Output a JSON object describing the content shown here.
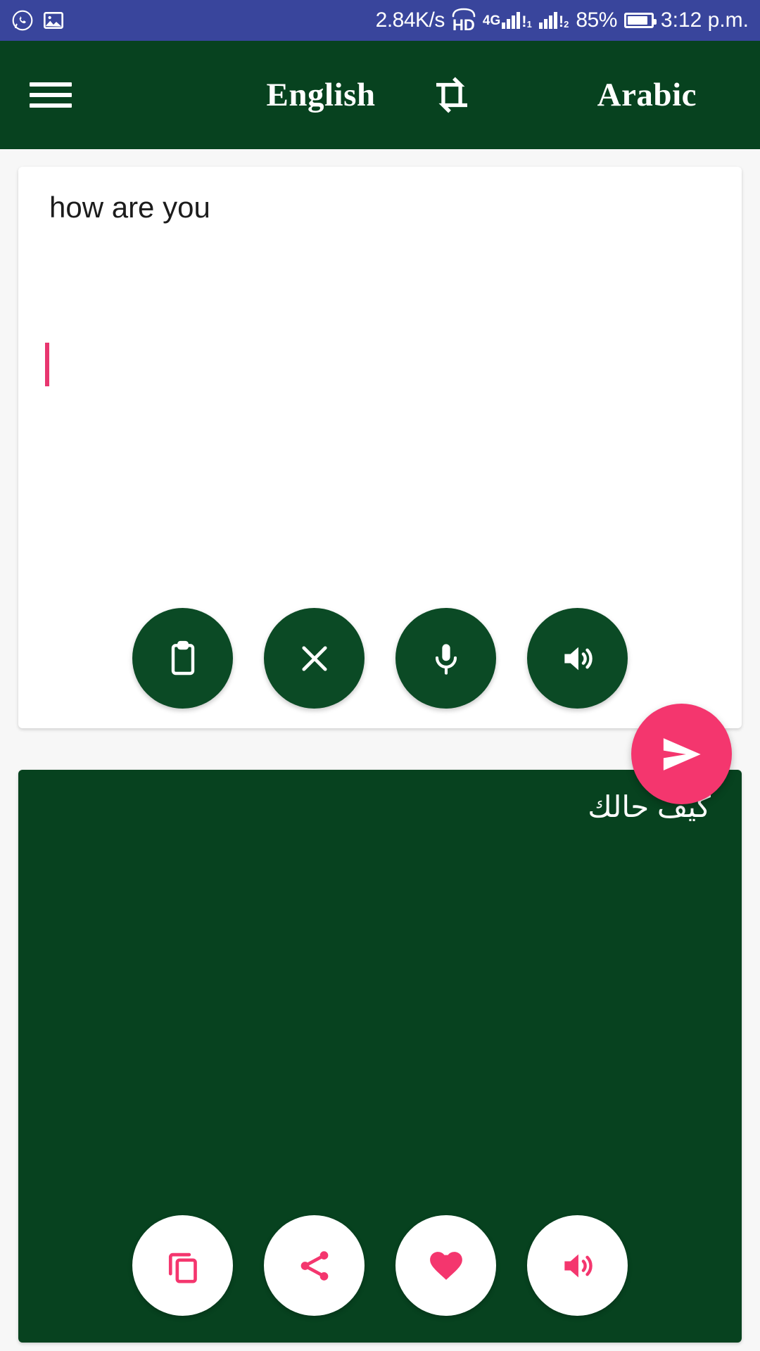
{
  "status_bar": {
    "network_speed": "2.84K/s",
    "hd_label": "HD",
    "network_type": "4G",
    "sim1_label": "1",
    "sim2_label": "2",
    "battery_percent": "85%",
    "time": "3:12 p.m.",
    "background_color": "#39459c",
    "icons": [
      "whatsapp-icon",
      "image-icon",
      "hd-call-icon",
      "signal-icon",
      "battery-icon"
    ]
  },
  "app_bar": {
    "menu_icon": "hamburger-menu-icon",
    "source_language": "English",
    "swap_icon": "swap-languages-icon",
    "target_language": "Arabic",
    "background_color": "#07421f"
  },
  "source_card": {
    "text": "how are you",
    "caret_color": "#e8366f",
    "actions": [
      {
        "name": "paste-button",
        "icon": "clipboard-icon",
        "label": "Paste"
      },
      {
        "name": "clear-button",
        "icon": "close-icon",
        "label": "Clear"
      },
      {
        "name": "voice-input-button",
        "icon": "microphone-icon",
        "label": "Voice input"
      },
      {
        "name": "speak-source-button",
        "icon": "speaker-icon",
        "label": "Speak"
      }
    ],
    "button_color": "#0b4a25"
  },
  "send_button": {
    "name": "translate-send-button",
    "icon": "send-icon",
    "label": "Translate",
    "color": "#f4366e"
  },
  "target_card": {
    "text": "كيف حالك",
    "background_color": "#07421f",
    "actions": [
      {
        "name": "copy-button",
        "icon": "copy-icon",
        "label": "Copy"
      },
      {
        "name": "share-button",
        "icon": "share-icon",
        "label": "Share"
      },
      {
        "name": "favorite-button",
        "icon": "heart-icon",
        "label": "Favorite"
      },
      {
        "name": "speak-target-button",
        "icon": "speaker-icon",
        "label": "Speak"
      }
    ],
    "icon_color": "#f4366e"
  }
}
